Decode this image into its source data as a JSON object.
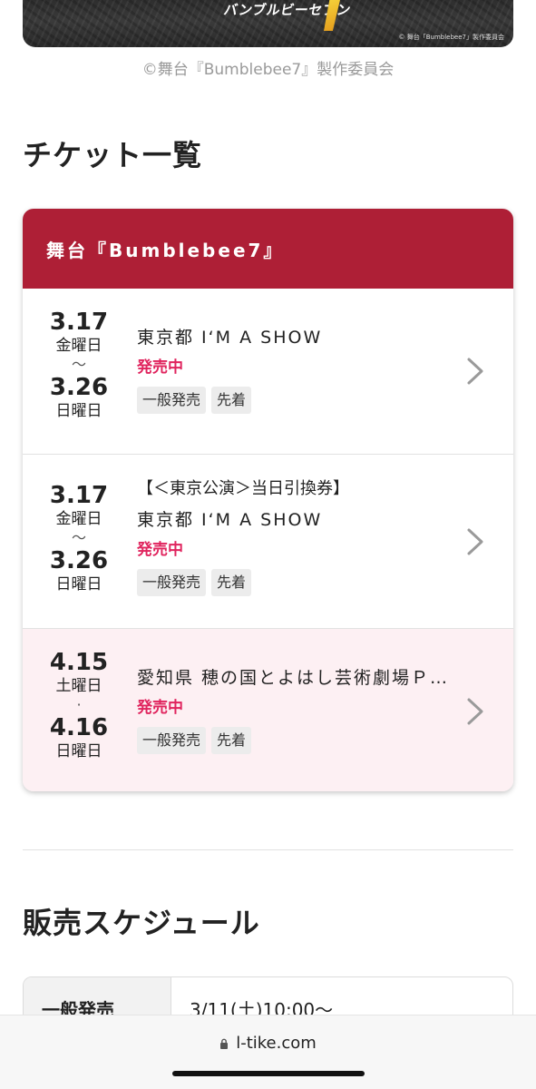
{
  "hero": {
    "logo_text": "バンブルビーセブン",
    "credit": "© 舞台「Bumblebee7」製作委員会"
  },
  "copyright": "©舞台『Bumblebee7』製作委員会",
  "ticket_section": {
    "title": "チケット一覧",
    "card_header": "舞台『Bumblebee7』",
    "items": [
      {
        "start_date": "3.17",
        "start_weekday": "金曜日",
        "separator": "〜",
        "end_date": "3.26",
        "end_weekday": "日曜日",
        "note": "",
        "venue": "東京都 I‘M A SHOW",
        "status": "発売中",
        "tags": [
          "一般発売",
          "先着"
        ]
      },
      {
        "start_date": "3.17",
        "start_weekday": "金曜日",
        "separator": "〜",
        "end_date": "3.26",
        "end_weekday": "日曜日",
        "note": "【＜東京公演＞当日引換券】",
        "venue": "東京都 I‘M A SHOW",
        "status": "発売中",
        "tags": [
          "一般発売",
          "先着"
        ]
      },
      {
        "start_date": "4.15",
        "start_weekday": "土曜日",
        "separator": "·",
        "end_date": "4.16",
        "end_weekday": "日曜日",
        "note": "",
        "venue": "愛知県 穂の国とよはし芸術劇場Ｐ…",
        "status": "発売中",
        "tags": [
          "一般発売",
          "先着"
        ]
      }
    ]
  },
  "schedule_section": {
    "title": "販売スケジュール",
    "rows": [
      {
        "label": "一般発売",
        "value": "3/11(土)10:00〜"
      }
    ]
  },
  "browser": {
    "url": "l-tike.com"
  },
  "colors": {
    "header_red": "#ae1f36",
    "status_pink": "#e0245e",
    "highlight_row": "#fdf0f3"
  },
  "icons": [
    "chevron-right-icon",
    "lock-icon"
  ]
}
